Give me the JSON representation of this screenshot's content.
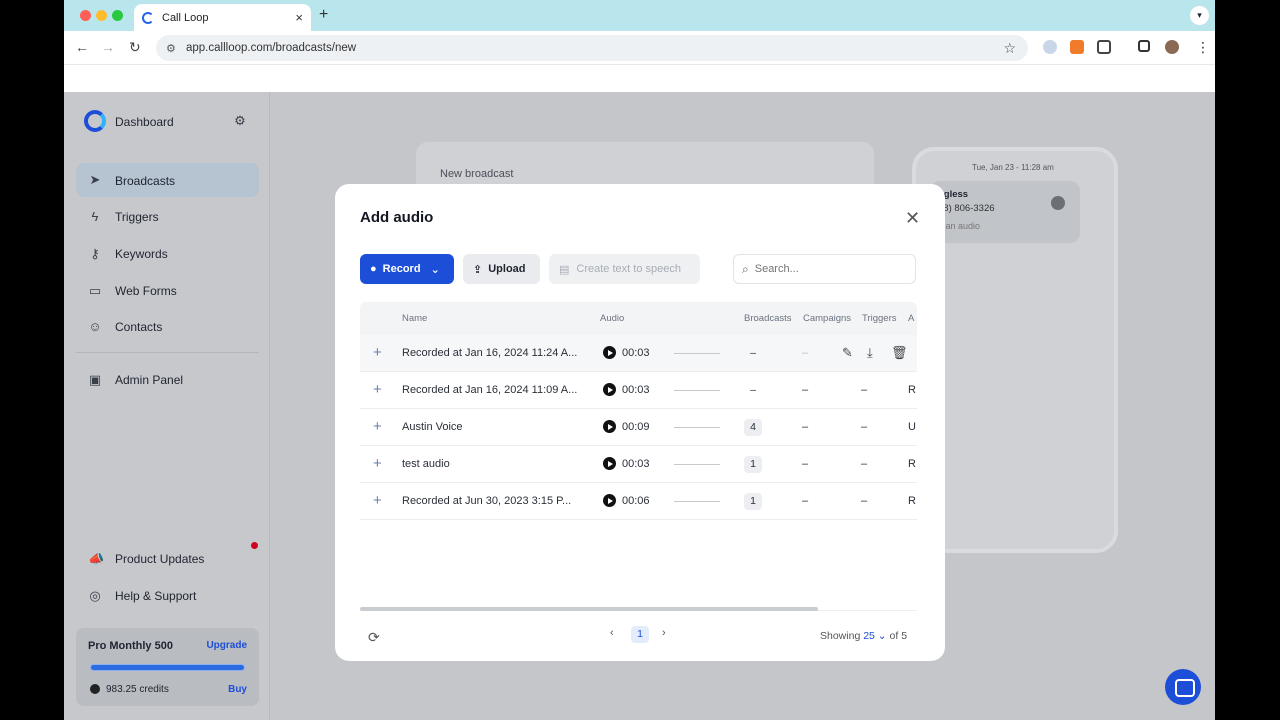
{
  "browser": {
    "tab_title": "Call Loop",
    "tab_close": "×",
    "new_tab": "+",
    "url": "app.callloop.com/broadcasts/new",
    "colors": {
      "tabbar": "#b8e6ec",
      "close": "#ff5f57",
      "min": "#febc2e",
      "max": "#28c840"
    }
  },
  "sidebar": {
    "dashboard": "Dashboard",
    "items": [
      {
        "label": "Broadcasts",
        "icon": "send-icon"
      },
      {
        "label": "Triggers",
        "icon": "bolt-icon"
      },
      {
        "label": "Keywords",
        "icon": "key-icon"
      },
      {
        "label": "Web Forms",
        "icon": "form-icon"
      },
      {
        "label": "Contacts",
        "icon": "users-icon"
      }
    ],
    "admin": "Admin Panel",
    "product_updates": "Product Updates",
    "help": "Help & Support",
    "plan": {
      "name": "Pro Monthly 500",
      "upgrade": "Upgrade",
      "credits": "983.25 credits",
      "buy": "Buy",
      "usage_fraction": 1.0
    }
  },
  "background": {
    "card_title": "New broadcast",
    "phone_time": "Tue, Jan 23 - 11:28 am",
    "phone_name": "ngless",
    "phone_number": "88) 806-3326",
    "phone_hint": "d an audio"
  },
  "modal": {
    "title": "Add audio",
    "record": "Record",
    "upload": "Upload",
    "tts": "Create text to speech",
    "search_placeholder": "Search...",
    "columns": {
      "name": "Name",
      "audio": "Audio",
      "broadcasts": "Broadcasts",
      "campaigns": "Campaigns",
      "triggers": "Triggers",
      "extra": "A"
    },
    "rows": [
      {
        "name": "Recorded at Jan 16, 2024 11:24 A...",
        "duration": "00:03",
        "broadcasts": "–",
        "campaigns": "–",
        "triggers": "",
        "extra": ""
      },
      {
        "name": "Recorded at Jan 16, 2024 11:09 A...",
        "duration": "00:03",
        "broadcasts": "–",
        "campaigns": "–",
        "triggers": "–",
        "extra": "R"
      },
      {
        "name": "Austin Voice",
        "duration": "00:09",
        "broadcasts": "4",
        "campaigns": "–",
        "triggers": "–",
        "extra": "U"
      },
      {
        "name": "test audio",
        "duration": "00:03",
        "broadcasts": "1",
        "campaigns": "–",
        "triggers": "–",
        "extra": "R"
      },
      {
        "name": "Recorded at Jun 30, 2023 3:15 P...",
        "duration": "00:06",
        "broadcasts": "1",
        "campaigns": "–",
        "triggers": "–",
        "extra": "R"
      }
    ],
    "pager": {
      "page": "1",
      "showing_label": "Showing",
      "per_page": "25",
      "of_label": "of 5"
    }
  }
}
